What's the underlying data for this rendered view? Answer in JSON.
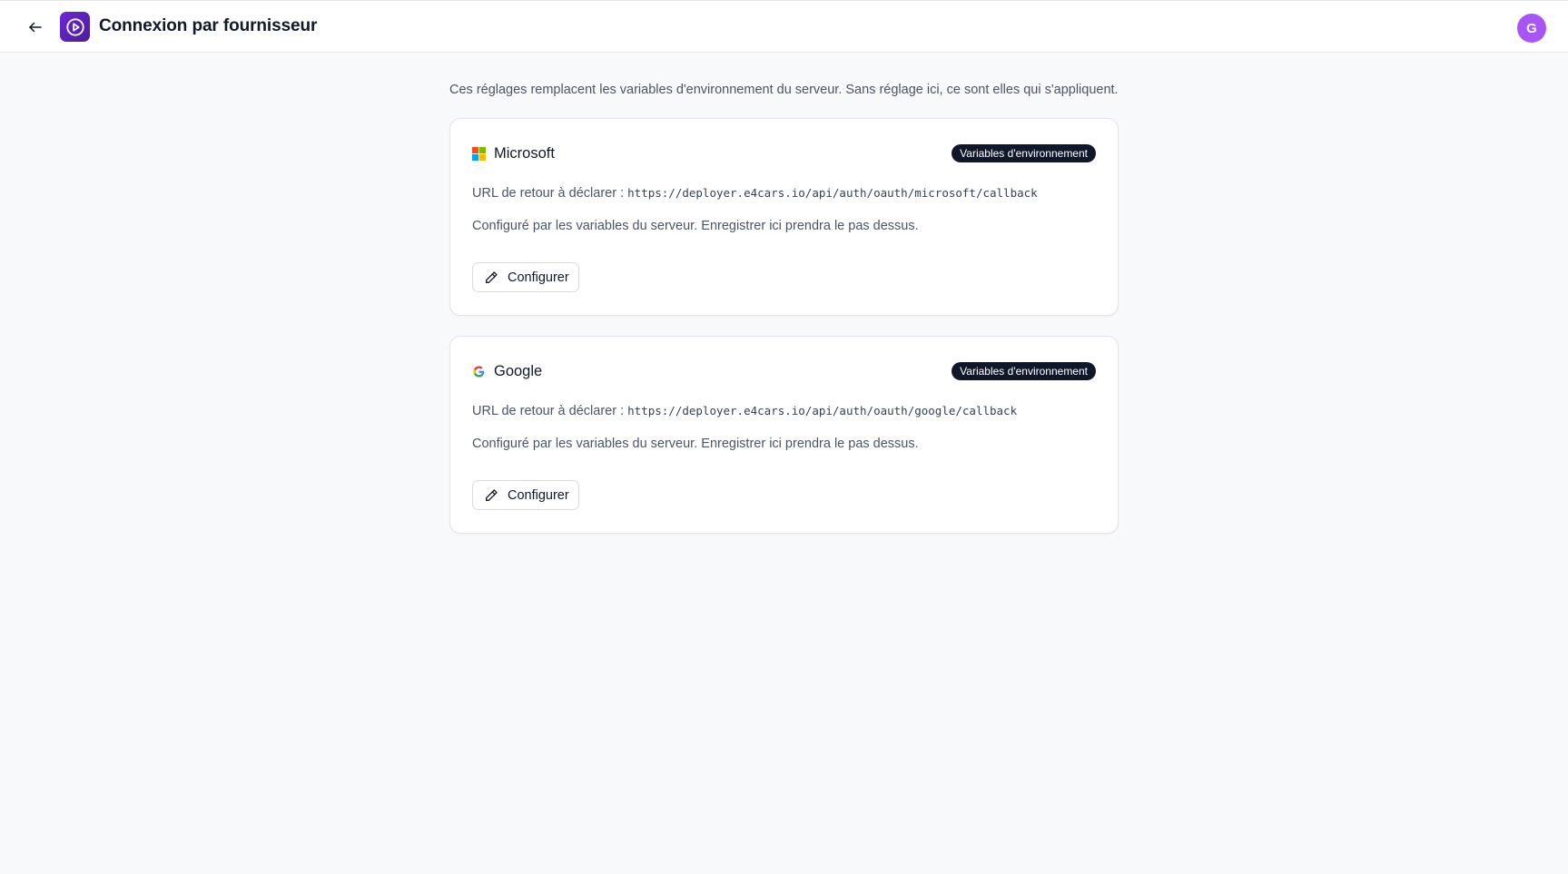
{
  "header": {
    "back_icon": "arrow-left-icon",
    "logo_icon": "play-circle-icon",
    "title": "Connexion par fournisseur",
    "avatar_initial": "G"
  },
  "intro": "Ces réglages remplacent les variables d'environnement du serveur. Sans réglage ici, ce sont elles qui s'appliquent.",
  "providers": [
    {
      "name": "Microsoft",
      "icon": "microsoft-icon",
      "badge": "Variables d'environnement",
      "url_label": "URL de retour à déclarer :",
      "url": "https://deployer.e4cars.io/api/auth/oauth/microsoft/callback",
      "description": "Configuré par les variables du serveur. Enregistrer ici prendra le pas dessus.",
      "button_label": "Configurer"
    },
    {
      "name": "Google",
      "icon": "google-icon",
      "badge": "Variables d'environnement",
      "url_label": "URL de retour à déclarer :",
      "url": "https://deployer.e4cars.io/api/auth/oauth/google/callback",
      "description": "Configuré par les variables du serveur. Enregistrer ici prendra le pas dessus.",
      "button_label": "Configurer"
    }
  ],
  "colors": {
    "accent": "#6d28d9",
    "avatar": "#a855f7",
    "badge_bg": "#0f172a",
    "background": "#f8f9fb"
  }
}
